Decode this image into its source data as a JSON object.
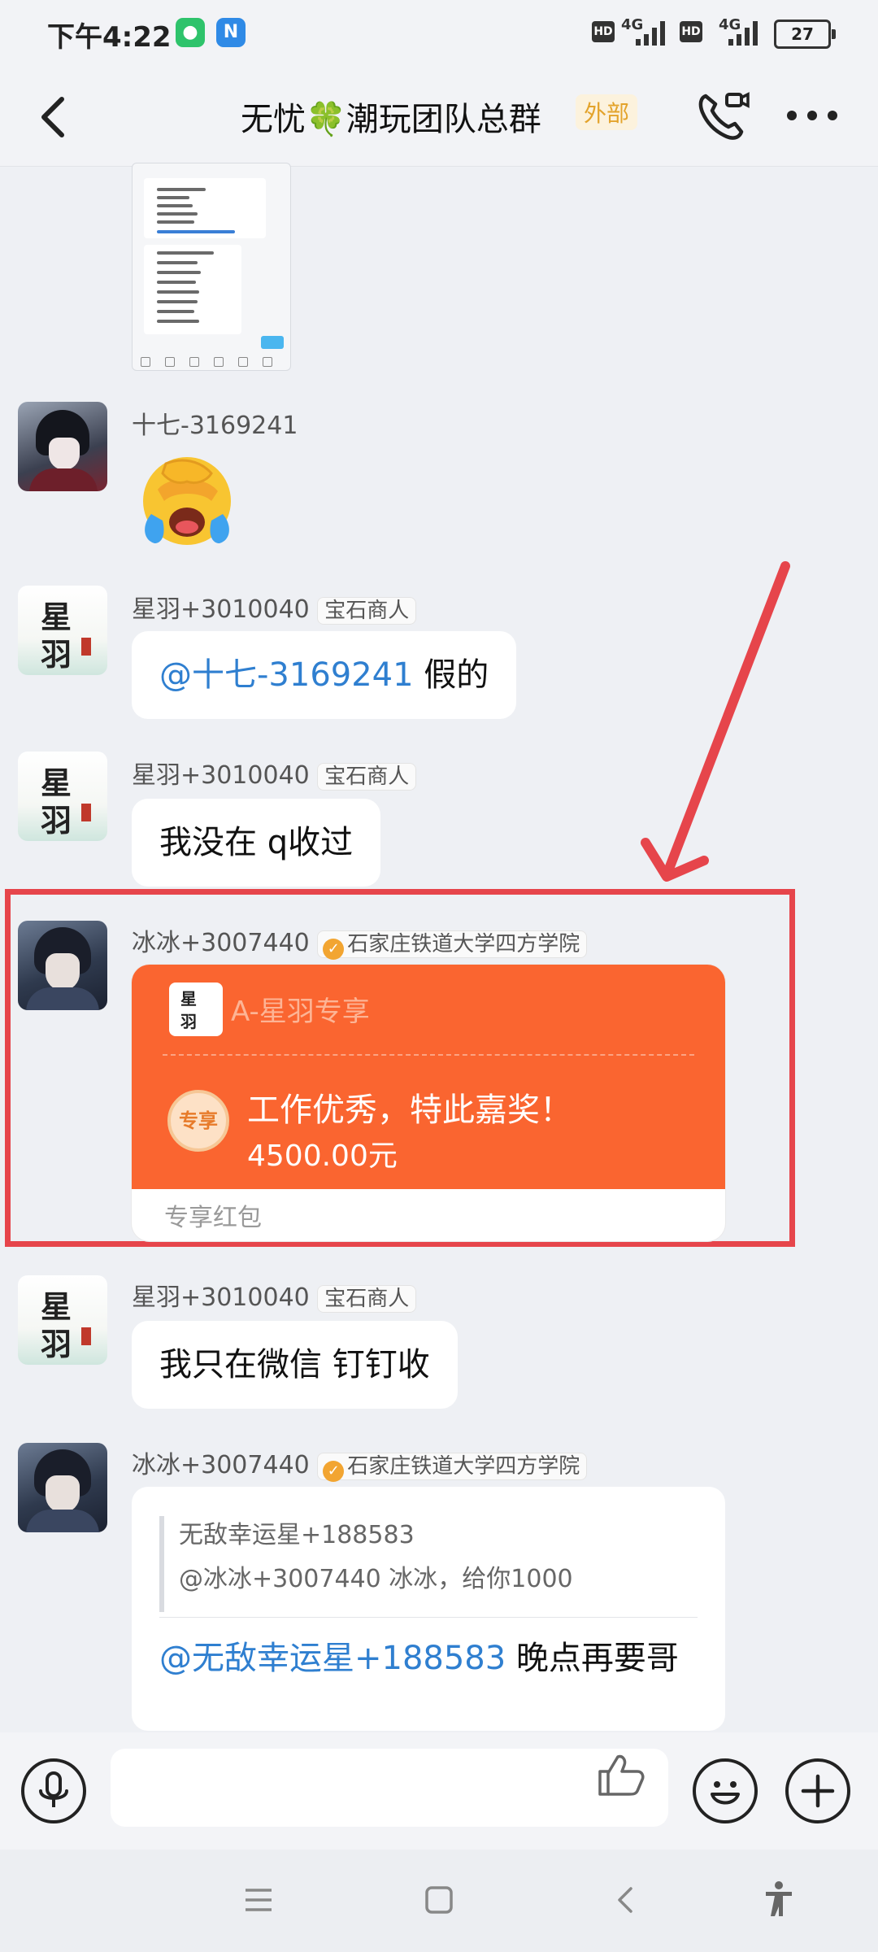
{
  "status_bar": {
    "time": "下午4:22",
    "signal_1": "4G",
    "signal_2": "4G",
    "hd_1": "HD",
    "hd_2": "HD",
    "battery": "27"
  },
  "header": {
    "title": "无忧🍀潮玩团队总群",
    "tag": "外部"
  },
  "messages": [
    {
      "sender": "十七-3169241"
    },
    {
      "sender": "星羽+3010040",
      "role": "宝石商人",
      "mention": "@十七-3169241",
      "text": " 假的"
    },
    {
      "sender": "星羽+3010040",
      "role": "宝石商人",
      "text": "我没在 q收过"
    },
    {
      "sender": "冰冰+3007440",
      "school": "石家庄铁道大学四方学院",
      "red_packet": {
        "to": "A-星羽专享",
        "badge": "专享",
        "blessing": "工作优秀，特此嘉奖！",
        "amount": "4500.00元",
        "type": "专享红包"
      }
    },
    {
      "sender": "星羽+3010040",
      "role": "宝石商人",
      "text": "我只在微信 钉钉收"
    },
    {
      "sender": "冰冰+3007440",
      "school": "石家庄铁道大学四方学院",
      "quote_author": "无敌幸运星+188583",
      "quote_text": "@冰冰+3007440 冰冰，给你1000",
      "mention": "@无敌幸运星+188583",
      "text": " 晚点再要哥"
    }
  ],
  "avatar_text": {
    "xingyu_1": "星",
    "xingyu_2": "羽"
  },
  "colors": {
    "accent": "#2f7fd0",
    "red_packet": "#fa6530",
    "highlight": "#e6454b",
    "tag_yellow": "#e3a32b"
  },
  "icons": [
    "back-arrow-icon",
    "video-call-icon",
    "more-icon",
    "voice-icon",
    "thumbs-up-icon",
    "emoji-icon",
    "plus-icon",
    "menu-icon",
    "home-icon",
    "back-nav-icon",
    "accessibility-icon"
  ]
}
